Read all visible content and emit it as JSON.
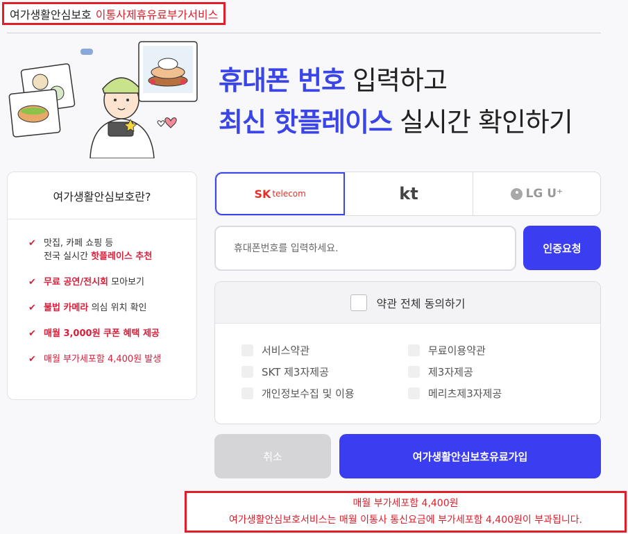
{
  "header": {
    "service_name": "여가생활안심보호",
    "service_type": "이통사제휴유료부가서비스"
  },
  "hero": {
    "line1_highlight": "휴대폰 번호",
    "line1_rest": " 입력하고",
    "line2_highlight": "최신 핫플레이스",
    "line2_rest": " 실시간 확인하기"
  },
  "info_card": {
    "title": "여가생활안심보호란?",
    "items": [
      {
        "line1": "맛집, 카페 쇼핑 등",
        "line2_prefix": "전국 실시간 ",
        "line2_highlight": "핫플레이스 추천"
      },
      {
        "highlight": "무료 공연/전시회",
        "rest": " 모아보기"
      },
      {
        "highlight": "불법 카메라",
        "rest": " 의심 위치 확인"
      },
      {
        "highlight": "매월 3,000원 쿠폰 혜택 제공"
      },
      {
        "text": "매월 부가세포함 4,400원 발생"
      }
    ]
  },
  "carriers": [
    {
      "name": "SK telecom",
      "logo_main": "SK",
      "logo_sub": "telecom",
      "selected": true
    },
    {
      "name": "kt",
      "logo_main": "kt",
      "selected": false
    },
    {
      "name": "LG U+",
      "logo_main": "LG U⁺",
      "selected": false
    }
  ],
  "phone": {
    "placeholder": "휴대폰번호를 입력하세요.",
    "value": "",
    "auth_button": "인증요청"
  },
  "terms": {
    "agree_all": "약관 전체 동의하기",
    "items": [
      "서비스약관",
      "무료이용약관",
      "SKT 제3자제공",
      "제3자제공",
      "개인정보수집 및 이용",
      "메리츠제3자제공"
    ]
  },
  "actions": {
    "cancel": "취소",
    "join": "여가생활안심보호유료가입"
  },
  "notice": {
    "line1": "매월 부가세포함 4,400원",
    "line2": "여가생활안심보호서비스는 매월 이통사 통신요금에 부가세포함 4,400원이 부과됩니다."
  },
  "colors": {
    "accent": "#3a3ef0",
    "highlight_red": "#d81f3a",
    "border_red": "#e11d2a",
    "disabled": "#d5d5d7"
  }
}
